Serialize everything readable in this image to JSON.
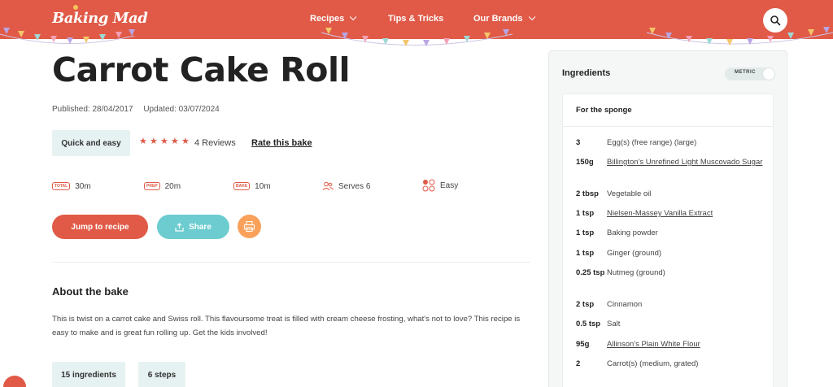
{
  "header": {
    "logo": "Baking Mad",
    "nav": [
      {
        "label": "Recipes",
        "has_chevron": true
      },
      {
        "label": "Tips & Tricks",
        "has_chevron": false
      },
      {
        "label": "Our Brands",
        "has_chevron": true
      }
    ],
    "search_icon": "search-icon",
    "brand_color": "#e05a47"
  },
  "recipe": {
    "title": "Carrot Cake Roll",
    "published": "Published: 28/04/2017",
    "updated": "Updated: 03/07/2024",
    "tag": "Quick and easy",
    "rating": 5,
    "reviews": "4 Reviews",
    "rate_label": "Rate this bake",
    "meta": {
      "total_badge": "TOTAL",
      "total": "30m",
      "prep_badge": "PREP",
      "prep": "20m",
      "bake_badge": "BAKE",
      "bake": "10m",
      "serves": "Serves 6",
      "difficulty": "Easy"
    },
    "buttons": {
      "jump": "Jump to recipe",
      "share": "Share"
    },
    "about_title": "About the bake",
    "about_text": "This is twist on a carrot cake and Swiss roll. This flavoursome treat is filled with cream cheese frosting, what's not to love? This recipe is easy to make and is great fun rolling up. Get the kids involved!",
    "counts": {
      "ingredients": "15 ingredients",
      "steps": "6 steps"
    }
  },
  "sidebar": {
    "title": "Ingredients",
    "unit_toggle": "METRIC",
    "section": "For the sponge",
    "ingredients": [
      {
        "qty": "3",
        "name": "Egg(s) (free range) (large)",
        "link": false
      },
      {
        "qty": "150g",
        "name": "Billington's Unrefined Light Muscovado Sugar",
        "link": true
      },
      {
        "qty": "2 tbsp",
        "name": "Vegetable oil",
        "link": false
      },
      {
        "qty": "1 tsp",
        "name": "Nielsen-Massey Vanilla Extract",
        "link": true
      },
      {
        "qty": "1 tsp",
        "name": "Baking powder",
        "link": false
      },
      {
        "qty": "1 tsp",
        "name": "Ginger (ground)",
        "link": false
      },
      {
        "qty": "0.25 tsp",
        "name": "Nutmeg (ground)",
        "link": false
      },
      {
        "qty": "2 tsp",
        "name": "Cinnamon",
        "link": false
      },
      {
        "qty": "0.5 tsp",
        "name": "Salt",
        "link": false
      },
      {
        "qty": "95g",
        "name": "Allinson's Plain White Flour",
        "link": true
      },
      {
        "qty": "2",
        "name": "Carrot(s) (medium, grated)",
        "link": false
      }
    ]
  }
}
